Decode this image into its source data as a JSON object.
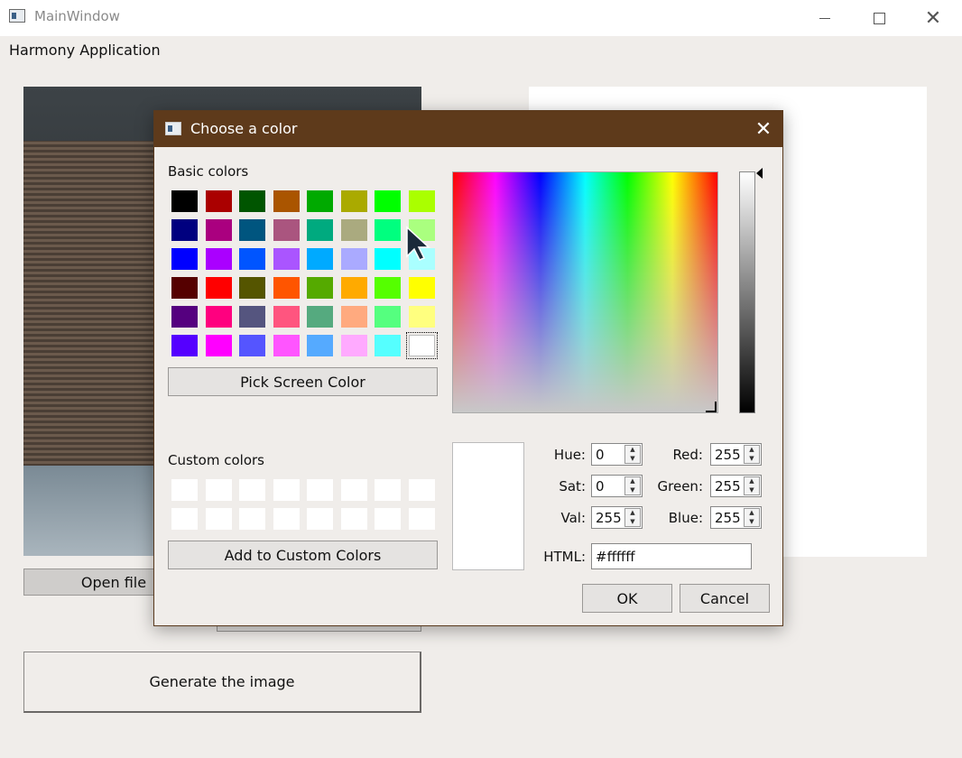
{
  "window": {
    "title": "MainWindow",
    "app_label": "Harmony Application",
    "icons": {
      "app": "app-window-icon",
      "minimize": "minimize-icon",
      "maximize": "maximize-icon",
      "close": "close-icon"
    }
  },
  "main": {
    "open_file_label": "Open file",
    "generate_label": "Generate the image"
  },
  "dialog": {
    "title": "Choose a color",
    "basic_colors_label": "Basic colors",
    "basic_colors": [
      [
        "#000000",
        "#aa0000",
        "#005500",
        "#aa5500",
        "#00aa00",
        "#aaaa00",
        "#00ff00",
        "#aaff00"
      ],
      [
        "#00007f",
        "#aa007f",
        "#00557f",
        "#aa557f",
        "#00aa7f",
        "#aaaa7f",
        "#00ff7f",
        "#aaff7f"
      ],
      [
        "#0000ff",
        "#aa00ff",
        "#0055ff",
        "#aa55ff",
        "#00aaff",
        "#aaaaff",
        "#00ffff",
        "#aaffff"
      ],
      [
        "#550000",
        "#ff0000",
        "#555500",
        "#ff5500",
        "#55aa00",
        "#ffaa00",
        "#55ff00",
        "#ffff00"
      ],
      [
        "#55007f",
        "#ff007f",
        "#55557f",
        "#ff557f",
        "#55aa7f",
        "#ffaa7f",
        "#55ff7f",
        "#ffff7f"
      ],
      [
        "#5500ff",
        "#ff00ff",
        "#5555ff",
        "#ff55ff",
        "#55aaff",
        "#ffaaff",
        "#55ffff",
        "#ffffff"
      ]
    ],
    "selected_swatch": "#ffffff",
    "pick_screen_label": "Pick Screen Color",
    "custom_colors_label": "Custom colors",
    "add_custom_label": "Add to Custom Colors",
    "fields": {
      "hue_label": "Hue:",
      "hue": "0",
      "sat_label": "Sat:",
      "sat": "0",
      "val_label": "Val:",
      "val": "255",
      "red_label": "Red:",
      "red": "255",
      "green_label": "Green:",
      "green": "255",
      "blue_label": "Blue:",
      "blue": "255",
      "html_label": "HTML:",
      "html": "#ffffff"
    },
    "ok_label": "OK",
    "cancel_label": "Cancel"
  }
}
